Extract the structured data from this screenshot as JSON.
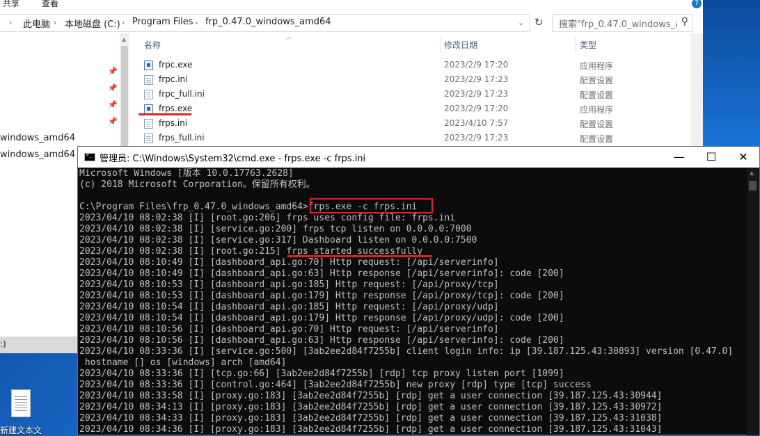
{
  "explorer": {
    "ribbon": [
      "共享",
      "查看"
    ],
    "help_icon": "?",
    "breadcrumb": [
      "此电脑",
      "本地磁盘 (C:)",
      "Program Files",
      "frp_0.47.0_windows_amd64"
    ],
    "search_placeholder": "搜索\"frp_0.47.0_windows_a...",
    "columns": [
      "名称",
      "修改日期",
      "类型"
    ],
    "files": [
      {
        "name": "frpc.exe",
        "date": "2023/2/9 17:20",
        "type": "应用程序",
        "icon": "exe-icon"
      },
      {
        "name": "frpc.ini",
        "date": "2023/2/9 17:23",
        "type": "配置设置",
        "icon": "ini-icon"
      },
      {
        "name": "frpc_full.ini",
        "date": "2023/2/9 17:23",
        "type": "配置设置",
        "icon": "ini-icon"
      },
      {
        "name": "frps.exe",
        "date": "2023/2/9 17:20",
        "type": "应用程序",
        "icon": "exe-icon"
      },
      {
        "name": "frps.ini",
        "date": "2023/4/10 7:57",
        "type": "配置设置",
        "icon": "ini-icon"
      },
      {
        "name": "frps_full.ini",
        "date": "2023/2/9 17:23",
        "type": "配置设置",
        "icon": "ini-icon"
      }
    ],
    "nav_fragments": [
      "windows_amd64",
      "windows_amd64"
    ],
    "selected_fragment": ":)"
  },
  "desktop": {
    "icon_label": "新建文本文"
  },
  "cmd": {
    "title": "管理员: C:\\Windows\\System32\\cmd.exe - frps.exe  -c frps.ini",
    "controls": {
      "minimize": "—",
      "maximize": "☐",
      "close": "✕"
    },
    "lines": [
      "Microsoft Windows [版本 10.0.17763.2628]",
      "(c) 2018 Microsoft Corporation。保留所有权利。",
      "",
      "C:\\Program Files\\frp_0.47.0_windows_amd64>frps.exe -c frps.ini",
      "2023/04/10 08:02:38 [I] [root.go:206] frps uses config file: frps.ini",
      "2023/04/10 08:02:38 [I] [service.go:200] frps tcp listen on 0.0.0.0:7000",
      "2023/04/10 08:02:38 [I] [service.go:317] Dashboard listen on 0.0.0.0:7500",
      "2023/04/10 08:02:38 [I] [root.go:215] frps started successfully",
      "2023/04/10 08:10:49 [I] [dashboard_api.go:70] Http request: [/api/serverinfo]",
      "2023/04/10 08:10:49 [I] [dashboard_api.go:63] Http response [/api/serverinfo]: code [200]",
      "2023/04/10 08:10:53 [I] [dashboard_api.go:185] Http request: [/api/proxy/tcp]",
      "2023/04/10 08:10:53 [I] [dashboard_api.go:179] Http response [/api/proxy/tcp]: code [200]",
      "2023/04/10 08:10:54 [I] [dashboard_api.go:185] Http request: [/api/proxy/udp]",
      "2023/04/10 08:10:54 [I] [dashboard_api.go:179] Http response [/api/proxy/udp]: code [200]",
      "2023/04/10 08:10:56 [I] [dashboard_api.go:70] Http request: [/api/serverinfo]",
      "2023/04/10 08:10:56 [I] [dashboard_api.go:63] Http response [/api/serverinfo]: code [200]",
      "2023/04/10 08:33:36 [I] [service.go:500] [3ab2ee2d84f7255b] client login info: ip [39.187.125.43:30893] version [0.47.0]",
      " hostname [] os [windows] arch [amd64]",
      "2023/04/10 08:33:36 [I] [tcp.go:66] [3ab2ee2d84f7255b] [rdp] tcp proxy listen port [1099]",
      "2023/04/10 08:33:36 [I] [control.go:464] [3ab2ee2d84f7255b] new proxy [rdp] type [tcp] success",
      "2023/04/10 08:33:58 [I] [proxy.go:183] [3ab2ee2d84f7255b] [rdp] get a user connection [39.187.125.43:30944]",
      "2023/04/10 08:34:13 [I] [proxy.go:183] [3ab2ee2d84f7255b] [rdp] get a user connection [39.187.125.43:30972]",
      "2023/04/10 08:34:33 [I] [proxy.go:183] [3ab2ee2d84f7255b] [rdp] get a user connection [39.187.125.43:31038]",
      "2023/04/10 08:34:36 [I] [proxy.go:183] [3ab2ee2d84f7255b] [rdp] get a user connection [39.187.125.43:31043]"
    ]
  },
  "colors": {
    "annotation_red": "#e0202e",
    "console_bg": "#0c0c0c",
    "console_text": "#c0c0c0"
  }
}
